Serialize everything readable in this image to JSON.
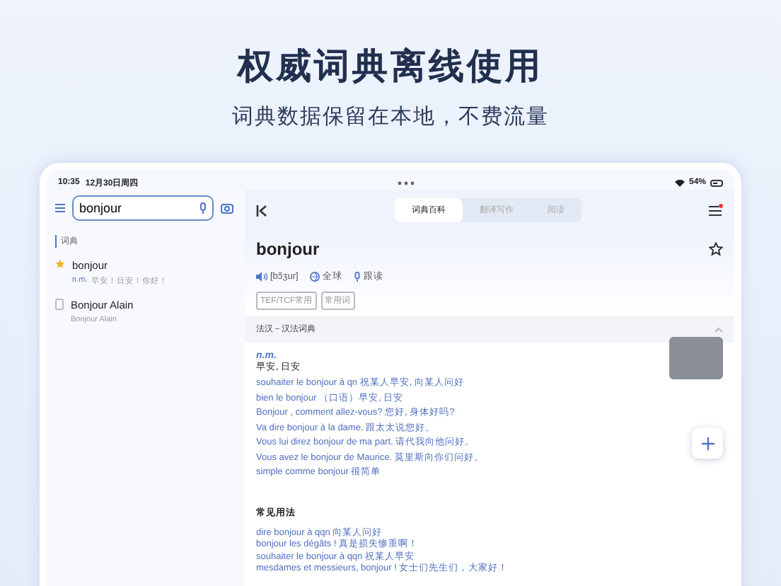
{
  "promo": {
    "headline": "权威词典离线使用",
    "subheadline": "词典数据保留在本地，不费流量"
  },
  "status_bar": {
    "time": "10:35",
    "date": "12月30日周四",
    "battery": "54%"
  },
  "sidebar": {
    "search": {
      "value": "bonjour"
    },
    "section": "词典",
    "results": [
      {
        "kind": "favorite",
        "word": "bonjour",
        "pos": "n.m.",
        "gloss": "早安！日安！你好！"
      },
      {
        "kind": "entry",
        "word": "Bonjour Alain",
        "gloss": "Bonjour Alain"
      }
    ]
  },
  "tabs": [
    {
      "label": "词典百科",
      "selected": true
    },
    {
      "label": "翻译写作",
      "selected": false
    },
    {
      "label": "阅读",
      "selected": false
    }
  ],
  "entry": {
    "headword": "bonjour",
    "pronunciation": "[bɔ̃ʒur]",
    "actions": [
      "全球",
      "跟读"
    ],
    "tags": [
      "TEF/TCF常用",
      "常用词"
    ],
    "dictionary": {
      "title": "法汉－汉法词典",
      "expanded": true
    },
    "pos": "n.m.",
    "meaning": "早安, 日安",
    "examples": [
      "souhaiter le bonjour à qn  祝某人早安, 向某人问好",
      "bien le bonjour  （口语）早安, 日安",
      "Bonjour , comment allez-vous?  您好, 身体好吗?",
      "Va dire bonjour à la dame.  跟太太说您好。",
      "Vous lui direz bonjour de ma part.  请代我向他问好。",
      "Vous avez le bonjour de Maurice.  莫里斯向你们问好。",
      "simple comme bonjour  很简单"
    ],
    "usage_title": "常见用法",
    "usages": [
      "dire bonjour à qqn 向某人问好",
      "bonjour les dégâts ! 真是损失惨重啊！",
      "souhaiter le bonjour à qqn 祝某人早安",
      "mesdames et messieurs, bonjour ! 女士们先生们，大家好！"
    ]
  }
}
